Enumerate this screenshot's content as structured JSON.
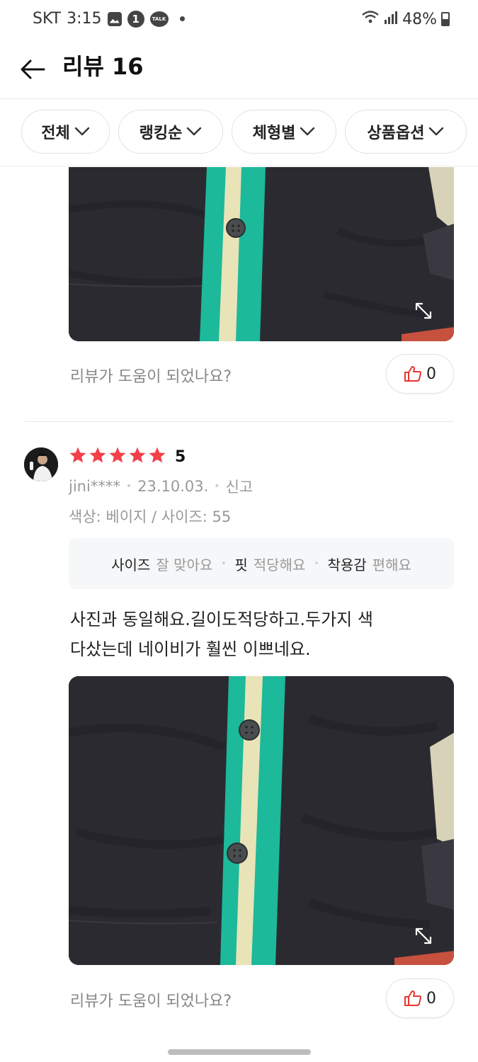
{
  "status_bar": {
    "carrier": "SKT",
    "time": "3:15",
    "notification_count": "1",
    "talk_label": "TALK",
    "battery_percent": "48%"
  },
  "header": {
    "title": "리뷰 16"
  },
  "filters": [
    {
      "label": "전체"
    },
    {
      "label": "랭킹순"
    },
    {
      "label": "체형별"
    },
    {
      "label": "상품옵션"
    }
  ],
  "reviews": [
    {
      "helpful_prompt": "리뷰가 도움이 되었나요?",
      "like_count": "0"
    },
    {
      "rating": 5,
      "rating_label": "5",
      "author": "jini****",
      "date": "23.10.03.",
      "report_label": "신고",
      "option_text": "색상: 베이지 / 사이즈: 55",
      "evaluations": [
        {
          "key": "사이즈",
          "value": "잘 맞아요"
        },
        {
          "key": "핏",
          "value": "적당해요"
        },
        {
          "key": "착용감",
          "value": "편해요"
        }
      ],
      "text": "사진과 동일해요.길이도적당하고.두가지 색\n다샀는데 네이비가 훨씬 이쁘네요.",
      "helpful_prompt": "리뷰가 도움이 되었나요?",
      "like_count": "0"
    }
  ],
  "colors": {
    "star": "#f2404a",
    "like_icon": "#e8352e",
    "garment_navy": "#2c2a31",
    "stripe_green": "#1cb99a",
    "stripe_cream": "#e9e3b8"
  }
}
